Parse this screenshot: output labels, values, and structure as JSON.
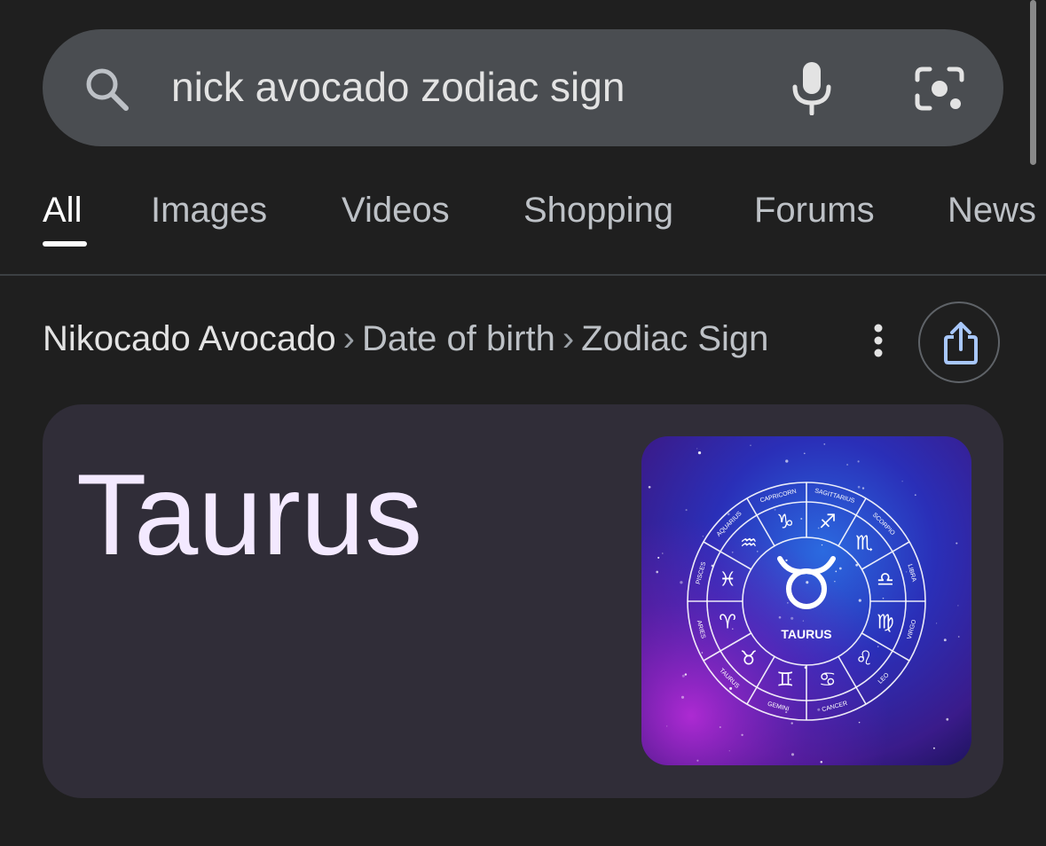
{
  "search": {
    "query": "nick avocado zodiac sign"
  },
  "tabs": [
    {
      "label": "All",
      "active": true
    },
    {
      "label": "Images",
      "active": false
    },
    {
      "label": "Videos",
      "active": false
    },
    {
      "label": "Shopping",
      "active": false
    },
    {
      "label": "Forums",
      "active": false
    },
    {
      "label": "News",
      "active": false
    }
  ],
  "breadcrumb": {
    "entity": "Nikocado Avocado",
    "separator": "›",
    "attribute": "Date of birth",
    "property": "Zodiac Sign"
  },
  "answer": {
    "value": "Taurus"
  },
  "zodiac_wheel": {
    "center_label": "TAURUS",
    "signs": [
      "CAPRICORN",
      "SAGITTARIUS",
      "SCORPIO",
      "LIBRA",
      "VIRGO",
      "LEO",
      "CANCER",
      "GEMINI",
      "TAURUS",
      "ARIES",
      "PISCES",
      "AQUARIUS"
    ],
    "symbols": [
      "♑",
      "♐",
      "♏",
      "♎",
      "♍",
      "♌",
      "♋",
      "♊",
      "♉",
      "♈",
      "♓",
      "♒"
    ]
  },
  "icons": {
    "search": "search-icon",
    "mic": "mic-icon",
    "lens": "camera-lens-icon",
    "more": "more-vert-icon",
    "share": "share-icon"
  },
  "colors": {
    "background": "#1f1f1f",
    "search_bar": "#4a4d51",
    "card": "#302d38",
    "answer_text": "#f3e9ff",
    "share_accent": "#a8c7fa"
  }
}
